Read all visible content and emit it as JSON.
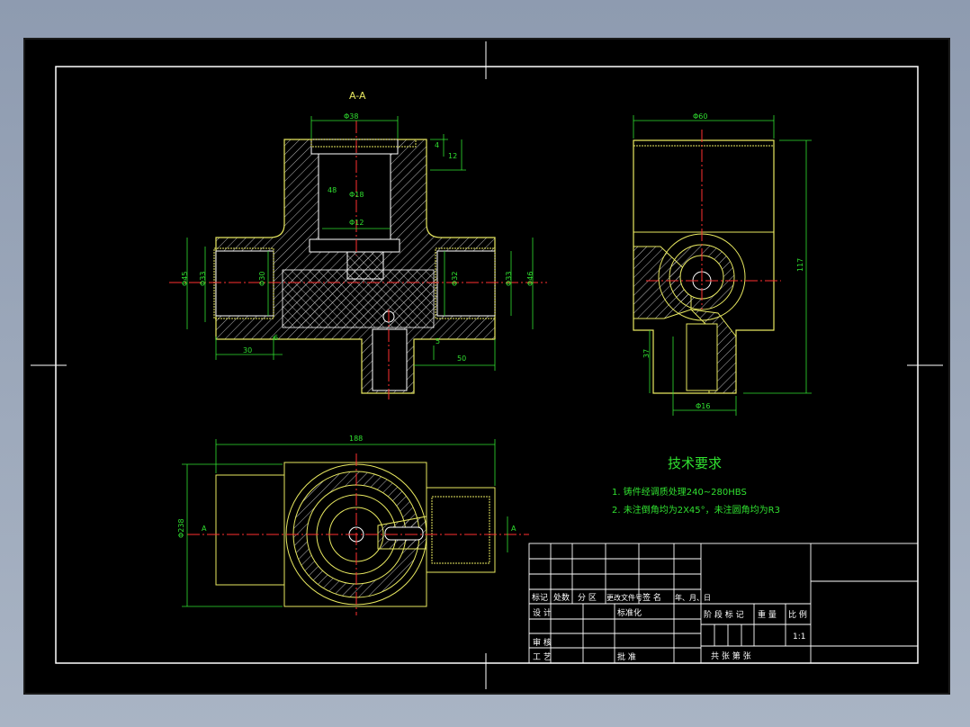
{
  "section_label": "A-A",
  "dims": {
    "phi38": "Φ38",
    "phi18": "Φ18",
    "phi12": "Φ12",
    "d4": "4",
    "d12": "12",
    "d48": "48",
    "phi45": "Φ45",
    "phi33": "Φ33",
    "phi30": "Φ30",
    "phi32": "Φ32",
    "phi46": "Φ46",
    "d30": "30",
    "d5": "5",
    "d6": "6",
    "d50": "50",
    "phi60": "Φ60",
    "d117": "117",
    "d37": "37",
    "phi16": "Φ16",
    "d188": "188",
    "phi238": "Φ238",
    "mark_a": "A"
  },
  "tech": {
    "title": "技术要求",
    "line1": "1. 铸件经调质处理240~280HBS",
    "line2": "2. 未注倒角均为2X45°，未注圆角均为R3"
  },
  "titleblock": {
    "biaoji": "标记",
    "chushu": "处数",
    "fenqu": "分 区",
    "gengai": "更改文件号",
    "qianming": "签 名",
    "nianyueri": "年、月、日",
    "sheji": "设 计",
    "biaozhunhua": "标准化",
    "shenhe": "审 核",
    "gongyi": "工 艺",
    "pizhun": "批 准",
    "jieduan": "阶 段 标 记",
    "zhongliang": "重 量",
    "bili": "比 例",
    "scale": "1:1",
    "gong_zhang": "共   张   第     张"
  }
}
